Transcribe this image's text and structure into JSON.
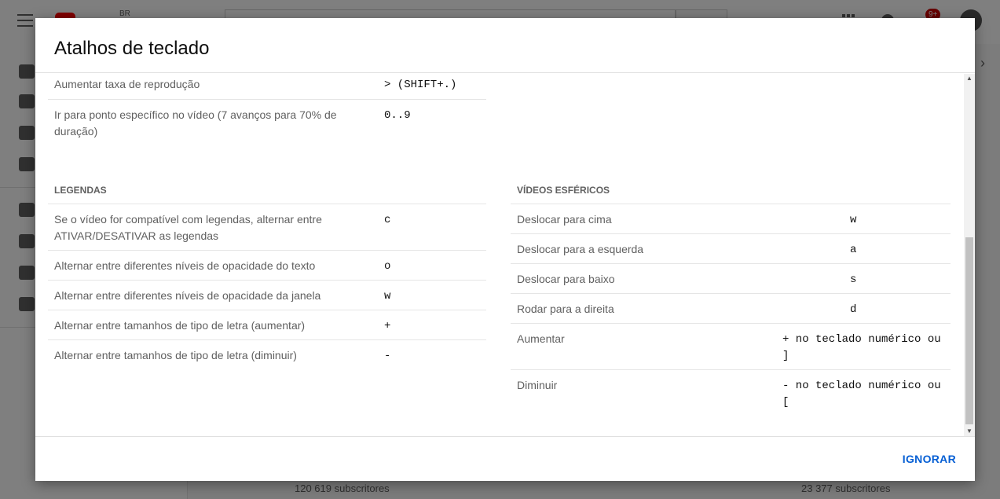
{
  "background": {
    "logo_country": "BR",
    "subscribers_left": "120 619 subscritores",
    "subscribers_right": "23 377 subscritores",
    "notification_badge": "9+"
  },
  "dialog": {
    "title": "Atalhos de teclado",
    "ignore_label": "IGNORAR"
  },
  "top_rows": [
    {
      "desc": "Aumentar taxa de reprodução",
      "key": "> (SHIFT+.)"
    },
    {
      "desc": "Ir para ponto específico no vídeo (7 avanços para 70% de duração)",
      "key": "0..9"
    }
  ],
  "subtitles": {
    "title": "LEGENDAS",
    "rows": [
      {
        "desc": "Se o vídeo for compatível com legendas, alternar entre ATIVAR/DESATIVAR as legendas",
        "key": "c"
      },
      {
        "desc": "Alternar entre diferentes níveis de opacidade do texto",
        "key": "o"
      },
      {
        "desc": "Alternar entre diferentes níveis de opacidade da janela",
        "key": "w"
      },
      {
        "desc": "Alternar entre tamanhos de tipo de letra (aumentar)",
        "key": "+"
      },
      {
        "desc": "Alternar entre tamanhos de tipo de letra (diminuir)",
        "key": "-"
      }
    ]
  },
  "spherical": {
    "title": "VÍDEOS ESFÉRICOS",
    "rows": [
      {
        "desc": "Deslocar para cima",
        "key": "w"
      },
      {
        "desc": "Deslocar para a esquerda",
        "key": "a"
      },
      {
        "desc": "Deslocar para baixo",
        "key": "s"
      },
      {
        "desc": "Rodar para a direita",
        "key": "d"
      },
      {
        "desc": "Aumentar",
        "key": "+ no teclado numérico ou ]"
      },
      {
        "desc": "Diminuir",
        "key": "- no teclado numérico ou ["
      }
    ]
  },
  "colors": {
    "accent": "#065fd4",
    "overlay": "rgba(0,0,0,0.5)"
  }
}
